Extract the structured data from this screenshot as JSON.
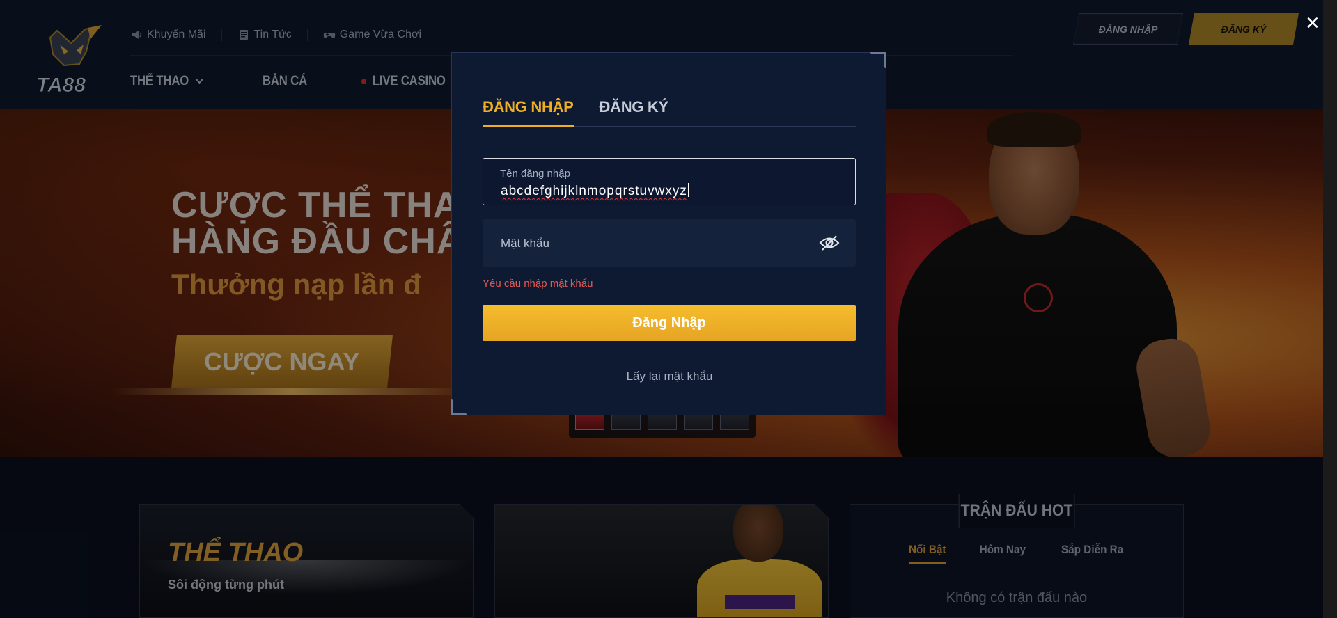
{
  "header": {
    "logo_text": "TA88",
    "top_links": [
      {
        "label": "Khuyến Mãi",
        "icon": "megaphone-icon"
      },
      {
        "label": "Tin Tức",
        "icon": "news-icon"
      },
      {
        "label": "Game Vừa Chơi",
        "icon": "gamepad-icon"
      }
    ],
    "nav": [
      {
        "label": "THỂ THAO",
        "icon": "chevron-down-icon"
      },
      {
        "label": "BẮN CÁ"
      },
      {
        "label": "LIVE CASINO",
        "icon": "live-dot-icon"
      }
    ],
    "login_label": "ĐĂNG NHẬP",
    "register_label": "ĐĂNG KÝ",
    "close_label": "✕"
  },
  "banner": {
    "line1": "CƯỢC THỂ THAO",
    "line2": "HÀNG ĐẦU CHÂU",
    "line3": "Thưởng nạp lần đ",
    "cta": "CƯỢC NGAY",
    "slides": 5,
    "active_slide": 0
  },
  "cards": {
    "sport_title": "THỂ THAO",
    "sport_sub": "Sôi động từng phút"
  },
  "hot_matches": {
    "title": "TRẬN ĐẤU HOT",
    "tabs": [
      "Nổi Bật",
      "Hôm Nay",
      "Sắp Diễn Ra"
    ],
    "active_tab": 0,
    "empty_text": "Không có trận đấu nào"
  },
  "modal": {
    "tabs": [
      "ĐĂNG NHẬP",
      "ĐĂNG KÝ"
    ],
    "active_tab": 0,
    "username_label": "Tên đăng nhập",
    "username_value": "abcdefghijklnmopqrstuvwxyz",
    "password_placeholder": "Mật khẩu",
    "password_error": "Yêu cầu nhập mật khẩu",
    "submit_label": "Đăng Nhập",
    "forgot_label": "Lấy lại mật khẩu"
  },
  "colors": {
    "accent": "#f0ae27",
    "error": "#e05a55",
    "modal_bg": "#0e1932",
    "page_bg": "#0b1120"
  }
}
